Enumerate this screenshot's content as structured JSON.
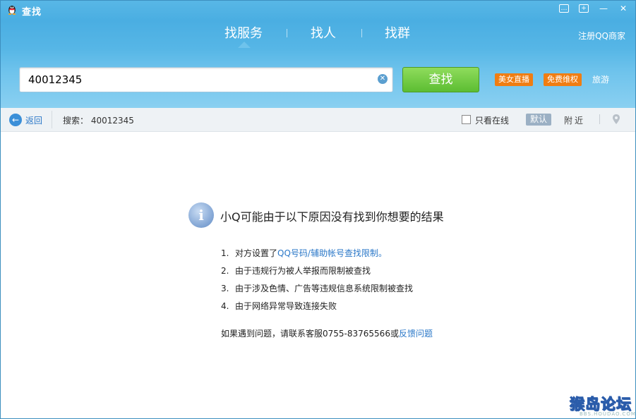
{
  "window": {
    "title": "查找",
    "buttons": [
      "feedback-icon",
      "skin-icon",
      "minimize-icon",
      "close-icon"
    ]
  },
  "tabs": [
    {
      "label": "找服务",
      "active": true
    },
    {
      "label": "找人",
      "active": false
    },
    {
      "label": "找群",
      "active": false
    }
  ],
  "header": {
    "register_link": "注册QQ商家"
  },
  "search": {
    "value": "40012345",
    "button_label": "查找",
    "promos": [
      "美女直播",
      "免费维权"
    ],
    "travel_link": "旅游"
  },
  "toolbar": {
    "back_label": "返回",
    "search_label": "搜索：  40012345",
    "online_only_label": "只看在线",
    "online_only_checked": false,
    "sort_default": "默认",
    "sort_nearby": "附近"
  },
  "result": {
    "title": "小Q可能由于以下原因没有找到你想要的结果",
    "reasons": [
      {
        "num": "1.",
        "text": "对方设置了",
        "link": "QQ号码/辅助帐号查找限制。"
      },
      {
        "num": "2.",
        "text": "由于违规行为被人举报而限制被查找",
        "link": ""
      },
      {
        "num": "3.",
        "text": "由于涉及色情、广告等违规信息系统限制被查找",
        "link": ""
      },
      {
        "num": "4.",
        "text": "由于网络异常导致连接失败",
        "link": ""
      }
    ],
    "contact_text": "如果遇到问题，请联系客服0755-83765566或",
    "contact_link": "反馈问题"
  },
  "watermark": {
    "main": "猴岛论坛",
    "sub": "BBS.HOUDAO.COM"
  },
  "colors": {
    "header_blue": "#4aaee2",
    "search_green": "#5cbd32",
    "promo_orange": "#f07d12",
    "link_blue": "#2b78c8"
  }
}
